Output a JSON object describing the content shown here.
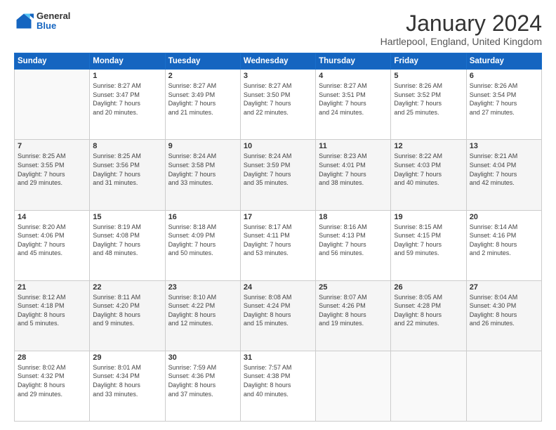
{
  "logo": {
    "general": "General",
    "blue": "Blue"
  },
  "title": "January 2024",
  "location": "Hartlepool, England, United Kingdom",
  "days_of_week": [
    "Sunday",
    "Monday",
    "Tuesday",
    "Wednesday",
    "Thursday",
    "Friday",
    "Saturday"
  ],
  "weeks": [
    [
      {
        "day": "",
        "info": ""
      },
      {
        "day": "1",
        "info": "Sunrise: 8:27 AM\nSunset: 3:47 PM\nDaylight: 7 hours\nand 20 minutes."
      },
      {
        "day": "2",
        "info": "Sunrise: 8:27 AM\nSunset: 3:49 PM\nDaylight: 7 hours\nand 21 minutes."
      },
      {
        "day": "3",
        "info": "Sunrise: 8:27 AM\nSunset: 3:50 PM\nDaylight: 7 hours\nand 22 minutes."
      },
      {
        "day": "4",
        "info": "Sunrise: 8:27 AM\nSunset: 3:51 PM\nDaylight: 7 hours\nand 24 minutes."
      },
      {
        "day": "5",
        "info": "Sunrise: 8:26 AM\nSunset: 3:52 PM\nDaylight: 7 hours\nand 25 minutes."
      },
      {
        "day": "6",
        "info": "Sunrise: 8:26 AM\nSunset: 3:54 PM\nDaylight: 7 hours\nand 27 minutes."
      }
    ],
    [
      {
        "day": "7",
        "info": "Sunrise: 8:25 AM\nSunset: 3:55 PM\nDaylight: 7 hours\nand 29 minutes."
      },
      {
        "day": "8",
        "info": "Sunrise: 8:25 AM\nSunset: 3:56 PM\nDaylight: 7 hours\nand 31 minutes."
      },
      {
        "day": "9",
        "info": "Sunrise: 8:24 AM\nSunset: 3:58 PM\nDaylight: 7 hours\nand 33 minutes."
      },
      {
        "day": "10",
        "info": "Sunrise: 8:24 AM\nSunset: 3:59 PM\nDaylight: 7 hours\nand 35 minutes."
      },
      {
        "day": "11",
        "info": "Sunrise: 8:23 AM\nSunset: 4:01 PM\nDaylight: 7 hours\nand 38 minutes."
      },
      {
        "day": "12",
        "info": "Sunrise: 8:22 AM\nSunset: 4:03 PM\nDaylight: 7 hours\nand 40 minutes."
      },
      {
        "day": "13",
        "info": "Sunrise: 8:21 AM\nSunset: 4:04 PM\nDaylight: 7 hours\nand 42 minutes."
      }
    ],
    [
      {
        "day": "14",
        "info": "Sunrise: 8:20 AM\nSunset: 4:06 PM\nDaylight: 7 hours\nand 45 minutes."
      },
      {
        "day": "15",
        "info": "Sunrise: 8:19 AM\nSunset: 4:08 PM\nDaylight: 7 hours\nand 48 minutes."
      },
      {
        "day": "16",
        "info": "Sunrise: 8:18 AM\nSunset: 4:09 PM\nDaylight: 7 hours\nand 50 minutes."
      },
      {
        "day": "17",
        "info": "Sunrise: 8:17 AM\nSunset: 4:11 PM\nDaylight: 7 hours\nand 53 minutes."
      },
      {
        "day": "18",
        "info": "Sunrise: 8:16 AM\nSunset: 4:13 PM\nDaylight: 7 hours\nand 56 minutes."
      },
      {
        "day": "19",
        "info": "Sunrise: 8:15 AM\nSunset: 4:15 PM\nDaylight: 7 hours\nand 59 minutes."
      },
      {
        "day": "20",
        "info": "Sunrise: 8:14 AM\nSunset: 4:16 PM\nDaylight: 8 hours\nand 2 minutes."
      }
    ],
    [
      {
        "day": "21",
        "info": "Sunrise: 8:12 AM\nSunset: 4:18 PM\nDaylight: 8 hours\nand 5 minutes."
      },
      {
        "day": "22",
        "info": "Sunrise: 8:11 AM\nSunset: 4:20 PM\nDaylight: 8 hours\nand 9 minutes."
      },
      {
        "day": "23",
        "info": "Sunrise: 8:10 AM\nSunset: 4:22 PM\nDaylight: 8 hours\nand 12 minutes."
      },
      {
        "day": "24",
        "info": "Sunrise: 8:08 AM\nSunset: 4:24 PM\nDaylight: 8 hours\nand 15 minutes."
      },
      {
        "day": "25",
        "info": "Sunrise: 8:07 AM\nSunset: 4:26 PM\nDaylight: 8 hours\nand 19 minutes."
      },
      {
        "day": "26",
        "info": "Sunrise: 8:05 AM\nSunset: 4:28 PM\nDaylight: 8 hours\nand 22 minutes."
      },
      {
        "day": "27",
        "info": "Sunrise: 8:04 AM\nSunset: 4:30 PM\nDaylight: 8 hours\nand 26 minutes."
      }
    ],
    [
      {
        "day": "28",
        "info": "Sunrise: 8:02 AM\nSunset: 4:32 PM\nDaylight: 8 hours\nand 29 minutes."
      },
      {
        "day": "29",
        "info": "Sunrise: 8:01 AM\nSunset: 4:34 PM\nDaylight: 8 hours\nand 33 minutes."
      },
      {
        "day": "30",
        "info": "Sunrise: 7:59 AM\nSunset: 4:36 PM\nDaylight: 8 hours\nand 37 minutes."
      },
      {
        "day": "31",
        "info": "Sunrise: 7:57 AM\nSunset: 4:38 PM\nDaylight: 8 hours\nand 40 minutes."
      },
      {
        "day": "",
        "info": ""
      },
      {
        "day": "",
        "info": ""
      },
      {
        "day": "",
        "info": ""
      }
    ]
  ]
}
